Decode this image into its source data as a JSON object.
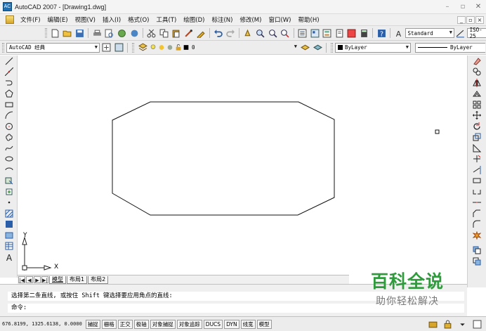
{
  "window": {
    "title": "AutoCAD 2007 - [Drawing1.dwg]",
    "app_icon_text": "AC",
    "controls": [
      "–",
      "▫",
      "✕"
    ]
  },
  "menu": {
    "items": [
      "文件(F)",
      "编辑(E)",
      "视图(V)",
      "插入(I)",
      "格式(O)",
      "工具(T)",
      "绘图(D)",
      "标注(N)",
      "修改(M)",
      "窗口(W)",
      "帮助(H)"
    ],
    "mdi_controls": [
      "_",
      "▫",
      "×"
    ]
  },
  "toolbar1": {
    "text_style": "Standard",
    "dim_style": "ISO-25"
  },
  "toolbar2": {
    "workspace": "AutoCAD 经典",
    "layer": "0",
    "color": "ByLayer",
    "linetype": "ByLayer"
  },
  "ucs": {
    "x_label": "X",
    "y_label": "Y"
  },
  "layout_tabs": {
    "nav": [
      "|◀",
      "◀",
      "▶",
      "▶|"
    ],
    "tabs": [
      "模型",
      "布局1",
      "布局2"
    ],
    "active": "模型"
  },
  "command": {
    "history": "选择第二条直线, 或按住 Shift 键选择要应用角点的直线:",
    "prompt": "命令:"
  },
  "status": {
    "coordinates": "676.8199, 1325.6138, 0.0000",
    "toggles": [
      "捕捉",
      "栅格",
      "正交",
      "极轴",
      "对象捕捉",
      "对象追踪",
      "DUCS",
      "DYN",
      "线宽",
      "模型"
    ]
  },
  "watermark": {
    "main": "百科全说",
    "sub": "助你轻松解决"
  },
  "colors": {
    "chrome": "#ededed",
    "canvas": "#ffffff",
    "watermark_green": "#2f9b3c"
  }
}
